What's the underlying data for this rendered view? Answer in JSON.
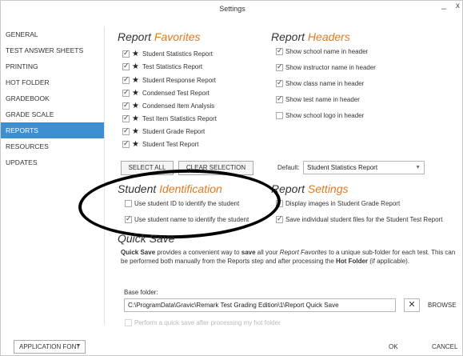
{
  "window": {
    "title": "Settings",
    "minimize": "–",
    "close": "x"
  },
  "sidebar": {
    "items": [
      {
        "label": "GENERAL"
      },
      {
        "label": "TEST ANSWER SHEETS"
      },
      {
        "label": "PRINTING"
      },
      {
        "label": "HOT FOLDER"
      },
      {
        "label": "GRADEBOOK"
      },
      {
        "label": "GRADE SCALE"
      },
      {
        "label": "REPORTS",
        "active": true
      },
      {
        "label": "RESOURCES"
      },
      {
        "label": "UPDATES"
      }
    ]
  },
  "report_favorites": {
    "title_a": "Report ",
    "title_b": "Favorites",
    "items": [
      {
        "label": "Student Statistics Report",
        "checked": true
      },
      {
        "label": "Test Statistics Report",
        "checked": true
      },
      {
        "label": "Student Response Report",
        "checked": true
      },
      {
        "label": "Condensed Test Report",
        "checked": true
      },
      {
        "label": "Condensed Item Analysis",
        "checked": true
      },
      {
        "label": "Test Item Statistics Report",
        "checked": true
      },
      {
        "label": "Student Grade Report",
        "checked": true
      },
      {
        "label": "Student Test Report",
        "checked": true
      }
    ],
    "select_all": "SELECT ALL",
    "clear_selection": "CLEAR SELECTION"
  },
  "report_headers": {
    "title_a": "Report ",
    "title_b": "Headers",
    "items": [
      {
        "label": "Show school name in header",
        "checked": true
      },
      {
        "label": "Show instructor name in header",
        "checked": true
      },
      {
        "label": "Show class name in header",
        "checked": true
      },
      {
        "label": "Show test name in header",
        "checked": true
      },
      {
        "label": "Show school logo in header",
        "checked": false
      }
    ],
    "default_label": "Default:",
    "default_value": "Student Statistics Report"
  },
  "student_identification": {
    "title_a": "Student ",
    "title_b": "Identification",
    "items": [
      {
        "label": "Use student ID to identify the student",
        "checked": false
      },
      {
        "label": "Use student name to identify the student",
        "checked": true
      }
    ]
  },
  "report_settings": {
    "title_a": "Report ",
    "title_b": "Settings",
    "items": [
      {
        "label": "Display images in Student Grade Report",
        "checked": false
      },
      {
        "label": "Save individual student files for the Student Test Report",
        "checked": true
      }
    ]
  },
  "quick_save": {
    "title": "Quick Save",
    "desc_1": "Quick Save",
    "desc_2": " provides a convenient way to ",
    "desc_3": "save",
    "desc_4": " all your ",
    "desc_5": "Report Favorites",
    "desc_6": " to a unique sub-folder for each test. This can be performed both manually from the Reports step and after processing the ",
    "desc_7": "Hot Folder",
    "desc_8": " (if applicable).",
    "base_folder_label": "Base folder:",
    "base_folder_value": "C:\\ProgramData\\Gravic\\Remark Test Grading Edition\\1\\Report Quick Save",
    "clear_icon": "✕",
    "browse": "BROWSE",
    "hotfolder_option": "Perform a quick save after processing my hot folder"
  },
  "footer": {
    "app_font": "APPLICATION FONT",
    "ok": "OK",
    "cancel": "CANCEL"
  }
}
